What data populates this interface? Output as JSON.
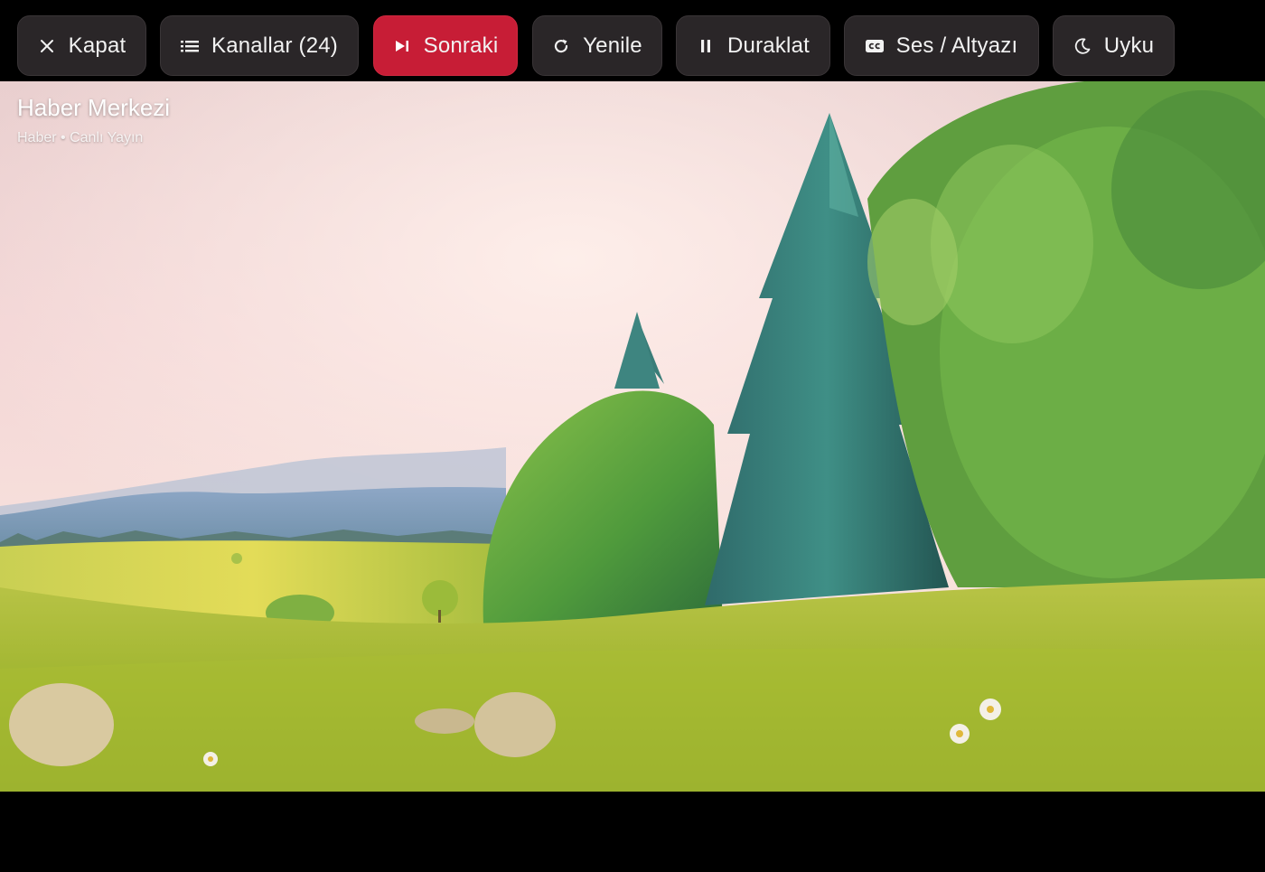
{
  "toolbar": {
    "close_label": "Kapat",
    "channels_label": "Kanallar (24)",
    "next_label": "Sonraki",
    "refresh_label": "Yenile",
    "pause_label": "Duraklat",
    "audio_subtitle_label": "Ses / Altyazı",
    "sleep_label": "Uyku"
  },
  "icons": {
    "close": "close-icon",
    "channels": "list-icon",
    "next": "skip-next-icon",
    "refresh": "refresh-icon",
    "pause": "pause-icon",
    "audio_subtitle": "closed-caption-icon",
    "sleep": "moon-icon"
  },
  "channel": {
    "name": "Haber Merkezi",
    "info": "Haber • Canlı Yayın"
  },
  "colors": {
    "accent": "#c71d36",
    "button_bg": "#2a2628",
    "background": "#000000"
  }
}
